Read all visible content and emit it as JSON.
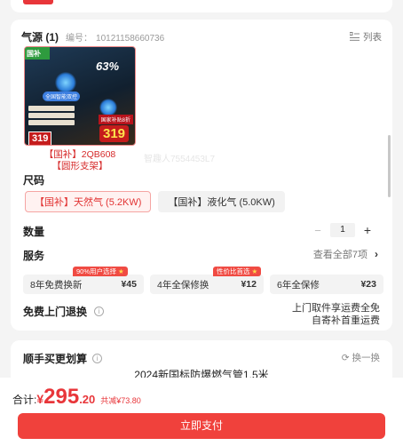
{
  "product": {
    "title": "气源 (1)",
    "serial_label": "编号：",
    "serial": "10121158660736",
    "list_label": "列表",
    "image_badge": "国补",
    "image_pct": "63%",
    "image_ribbon": "全国智能双控",
    "image_tag": "国家补贴8折",
    "image_price_small": "319",
    "image_price_big": "319",
    "name_line1": "【国补】2QB608",
    "name_line2": "【圆形支架】",
    "watermark": "智趣人7554453L7"
  },
  "size": {
    "label": "尺码",
    "options": [
      {
        "label": "【国补】天然气 (5.2KW)",
        "selected": true
      },
      {
        "label": "【国补】液化气 (5.0KW)",
        "selected": false
      }
    ]
  },
  "quantity": {
    "label": "数量",
    "minus": "−",
    "value": "1",
    "plus": "+"
  },
  "service": {
    "label": "服务",
    "view_all": "查看全部7项",
    "items": [
      {
        "name": "8年免费换新",
        "price": "¥45",
        "tag": "90%用户选择"
      },
      {
        "name": "4年全保修换",
        "price": "¥12",
        "tag": "性价比首选"
      },
      {
        "name": "6年全保修",
        "price": "¥23",
        "tag": ""
      }
    ]
  },
  "free_return": {
    "label": "免费上门退换",
    "line1": "上门取件享运费全免",
    "line2": "自寄补首重运费"
  },
  "bundle": {
    "title": "顺手买更划算",
    "swap": "换一换",
    "item": "2024新国标防爆燃气管1.5米"
  },
  "footer": {
    "total_label": "合计:",
    "currency": "¥",
    "amount_int": "295",
    "amount_dec": ".20",
    "saved": "共减¥73.80",
    "pay_button": "立即支付"
  },
  "colors": {
    "accent": "#e8363a",
    "pay": "#f0413c"
  }
}
